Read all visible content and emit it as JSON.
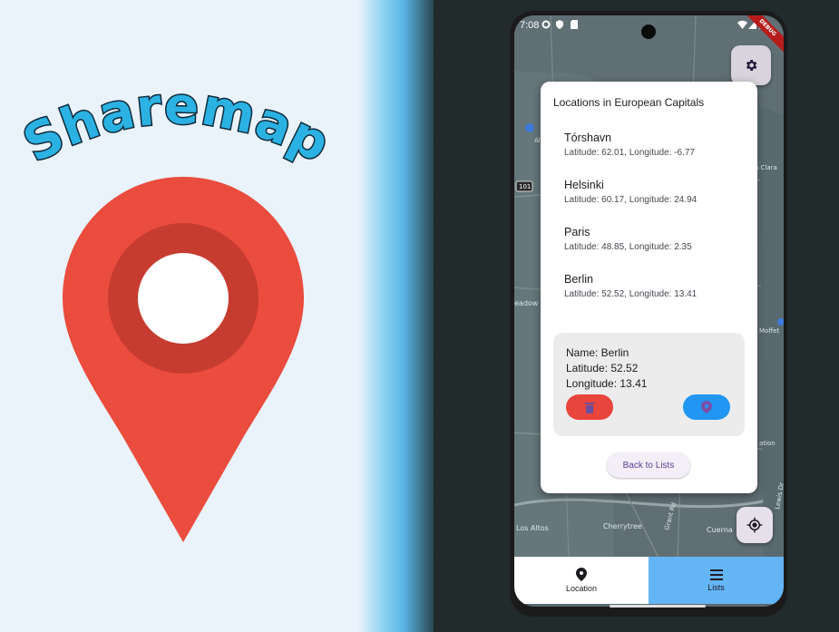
{
  "app": {
    "title": "Sharemap"
  },
  "colors": {
    "pin_red": "#ea4c3d",
    "pin_ring": "#c73c30",
    "accent_blue": "#2196f3",
    "nav_selected": "#64b5f6",
    "delete_red": "#e8453c"
  },
  "statusbar": {
    "time": "7:08",
    "debug_banner": "DEBUG"
  },
  "dialog": {
    "title": "Locations in European Capitals",
    "locations": [
      {
        "name": "Tórshavn",
        "coords": "Latitude: 62.01, Longitude: -6.77"
      },
      {
        "name": "Helsinki",
        "coords": "Latitude: 60.17, Longitude: 24.94"
      },
      {
        "name": "Paris",
        "coords": "Latitude: 48.85, Longitude: 2.35"
      },
      {
        "name": "Berlin",
        "coords": "Latitude: 52.52, Longitude: 13.41"
      }
    ],
    "detail": {
      "name": "Name: Berlin",
      "latitude": "Latitude: 52.52",
      "longitude": "Longitude: 13.41"
    },
    "back_label": "Back to Lists"
  },
  "map_labels": {
    "l1": "Alto Airp",
    "l2": "a Clara",
    "l3": "101",
    "l4": "eadow",
    "l5": "Moffet",
    "l6": "ation",
    "l7": "Los Altos",
    "l8": "Cherrytree",
    "l9": "Cuerna",
    "l10": "Grant Rd",
    "l11": "Lewis Dr"
  },
  "bottom_nav": {
    "items": [
      {
        "label": "Location",
        "icon": "location-pin-icon"
      },
      {
        "label": "Lists",
        "icon": "menu-icon"
      }
    ],
    "selected": "Lists"
  }
}
